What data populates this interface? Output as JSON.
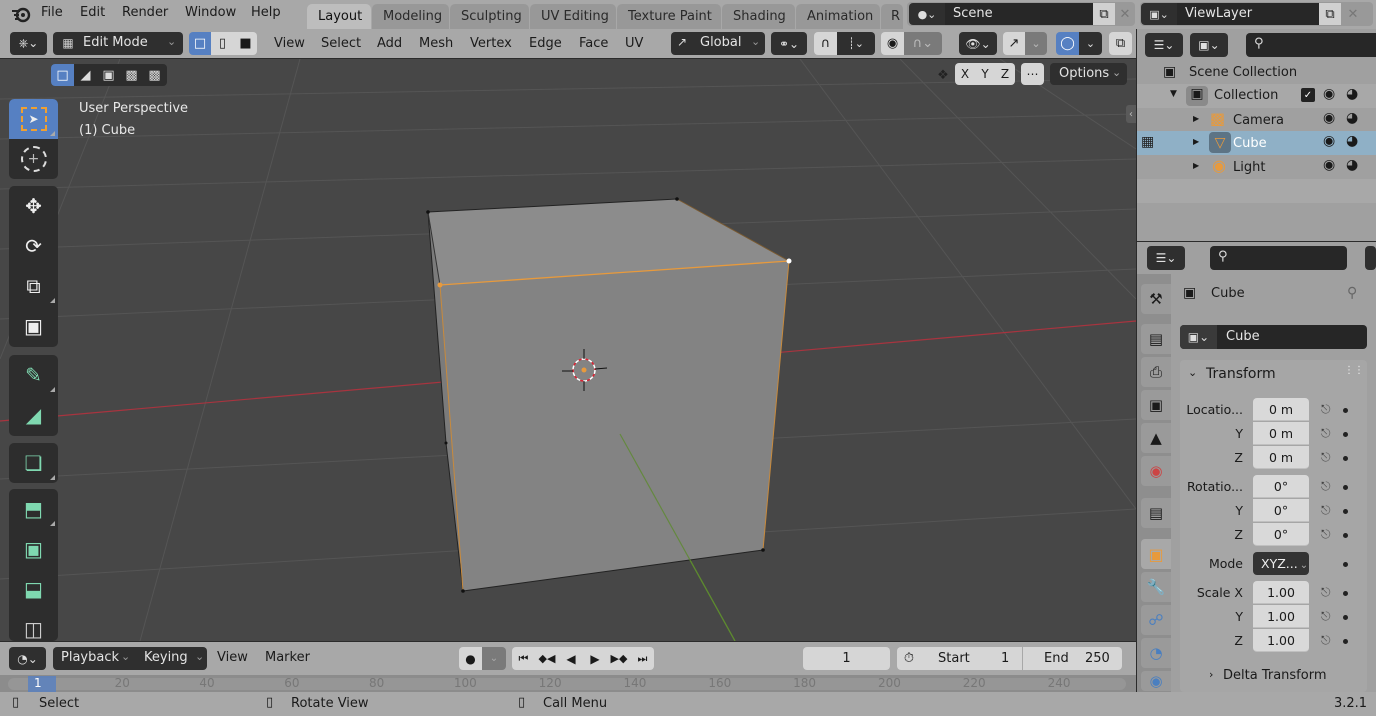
{
  "topbar": {
    "menus": [
      "File",
      "Edit",
      "Render",
      "Window",
      "Help"
    ],
    "workspace_tabs": [
      {
        "label": "Layout",
        "active": true
      },
      {
        "label": "Modeling",
        "active": false
      },
      {
        "label": "Sculpting",
        "active": false
      },
      {
        "label": "UV Editing",
        "active": false
      },
      {
        "label": "Texture Paint",
        "active": false
      },
      {
        "label": "Shading",
        "active": false
      },
      {
        "label": "Animation",
        "active": false
      },
      {
        "label": "R",
        "active": false
      }
    ],
    "scene": "Scene",
    "view_layer": "ViewLayer"
  },
  "header": {
    "mode": "Edit Mode",
    "menus": [
      "View",
      "Select",
      "Add",
      "Mesh",
      "Vertex",
      "Edge",
      "Face",
      "UV"
    ],
    "transform_orientation": "Global",
    "axis_buttons": [
      "X",
      "Y",
      "Z"
    ],
    "options_label": "Options"
  },
  "viewport": {
    "perspective_label": "User Perspective",
    "object_label": "(1) Cube",
    "colors": {
      "selected_edge": "#e89a3c",
      "x_axis": "#a8343f",
      "y_axis": "#5d8a2f",
      "background": "#474747"
    }
  },
  "toolbar": {
    "tools": [
      "select-box",
      "cursor",
      "move",
      "rotate",
      "scale",
      "transform",
      "annotate",
      "measure",
      "add-cube",
      "extrude",
      "inset",
      "bevel",
      "loop-cut"
    ]
  },
  "outliner": {
    "root": "Scene Collection",
    "collection": "Collection",
    "items": [
      {
        "label": "Camera",
        "icon": "camera-icon",
        "selected": false
      },
      {
        "label": "Cube",
        "icon": "mesh-icon",
        "selected": true
      },
      {
        "label": "Light",
        "icon": "light-icon",
        "selected": false
      }
    ]
  },
  "properties": {
    "object_name": "Cube",
    "datablock_name": "Cube",
    "panel_title": "Transform",
    "location": {
      "label": "Locatio...",
      "x": "0 m",
      "y": "0 m",
      "z": "0 m"
    },
    "rotation": {
      "label": "Rotatio...",
      "x": "0°",
      "y": "0°",
      "z": "0°"
    },
    "mode": {
      "label": "Mode",
      "value": "XYZ..."
    },
    "scale": {
      "label": "Scale X",
      "x": "1.00",
      "y": "1.00",
      "z": "1.00"
    },
    "axis_labels": {
      "y": "Y",
      "z": "Z"
    },
    "delta_panel": "Delta Transform"
  },
  "timeline": {
    "menus": [
      "Playback",
      "Keying",
      "View",
      "Marker"
    ],
    "current_frame": "1",
    "start_label": "Start",
    "start": "1",
    "end_label": "End",
    "end": "250",
    "ruler_ticks": [
      "1",
      "20",
      "40",
      "60",
      "80",
      "100",
      "120",
      "140",
      "160",
      "180",
      "200",
      "220",
      "240"
    ]
  },
  "statusbar": {
    "hints": [
      {
        "label": "Select"
      },
      {
        "label": "Rotate View"
      },
      {
        "label": "Call Menu"
      }
    ],
    "version": "3.2.1"
  }
}
